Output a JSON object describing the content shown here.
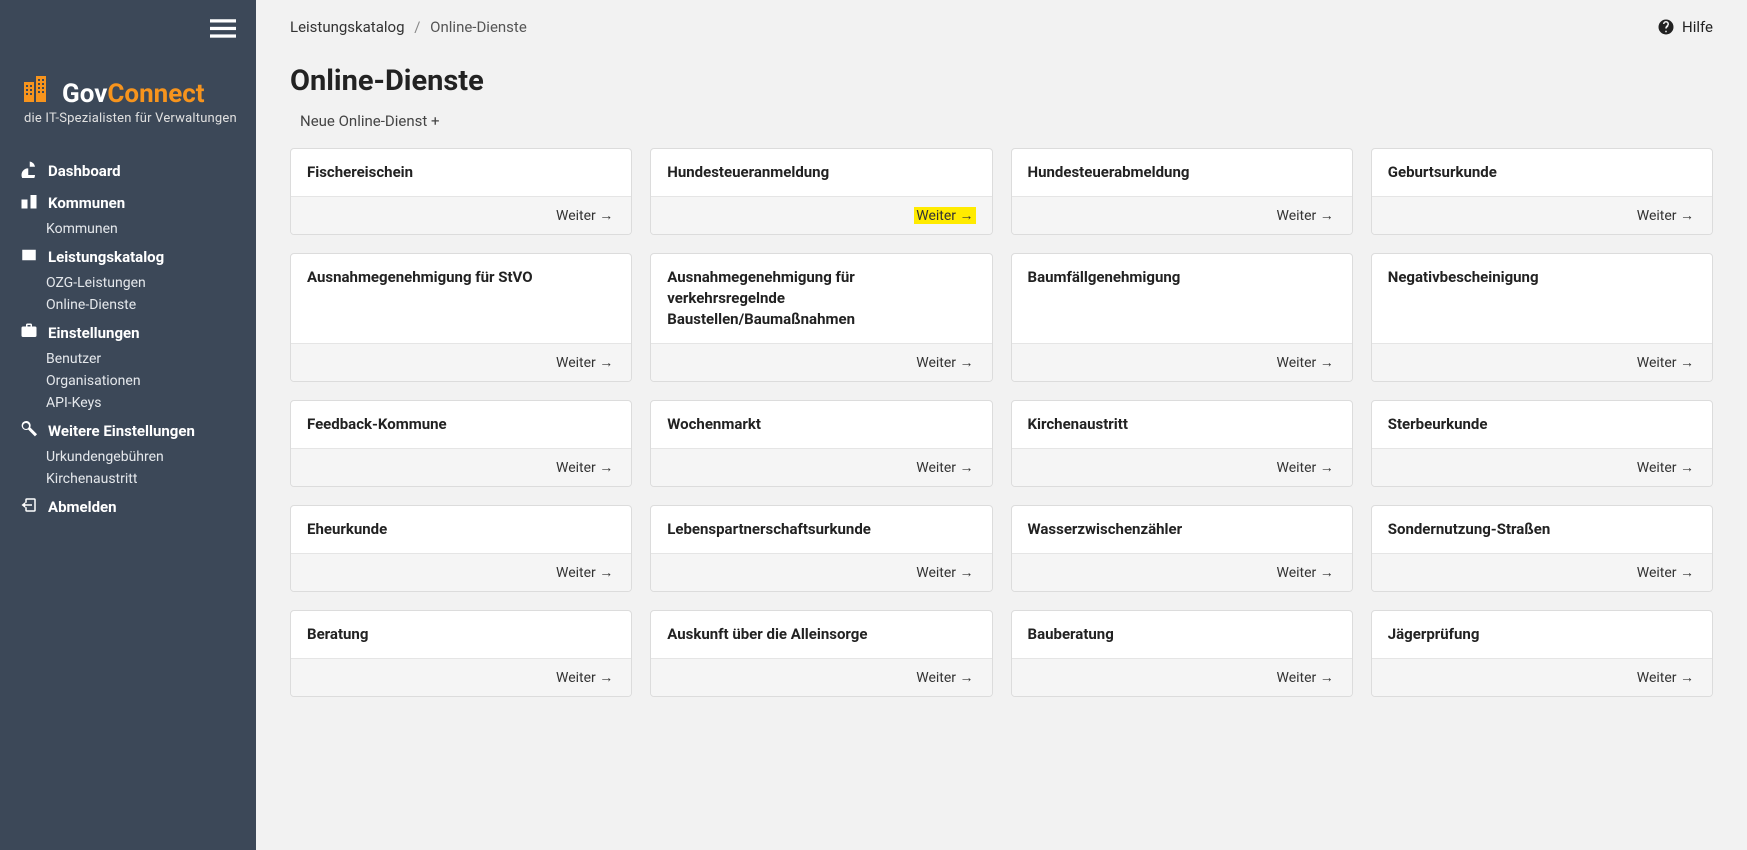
{
  "logo": {
    "gov": "Gov",
    "connect": "Connect",
    "subtitle": "die IT-Spezialisten für Verwaltungen"
  },
  "sidebar": {
    "groups": [
      {
        "label": "Dashboard",
        "sub": []
      },
      {
        "label": "Kommunen",
        "sub": [
          "Kommunen"
        ]
      },
      {
        "label": "Leistungskatalog",
        "sub": [
          "OZG-Leistungen",
          "Online-Dienste"
        ]
      },
      {
        "label": "Einstellungen",
        "sub": [
          "Benutzer",
          "Organisationen",
          "API-Keys"
        ]
      },
      {
        "label": "Weitere Einstellungen",
        "sub": [
          "Urkundengebühren",
          "Kirchenaustritt"
        ]
      },
      {
        "label": "Abmelden",
        "sub": []
      }
    ]
  },
  "breadcrumb": {
    "parent": "Leistungskatalog",
    "sep": "/",
    "current": "Online-Dienste"
  },
  "help": {
    "label": "Hilfe"
  },
  "page_title": "Online-Dienste",
  "add_link": "Neue Online-Dienst +",
  "weiter_label": "Weiter →",
  "cards": [
    {
      "title": "Fischereischein",
      "highlighted": false
    },
    {
      "title": "Hundesteueranmeldung",
      "highlighted": true
    },
    {
      "title": "Hundesteuerabmeldung",
      "highlighted": false
    },
    {
      "title": "Geburtsurkunde",
      "highlighted": false
    },
    {
      "title": "Ausnahmegenehmigung für StVO",
      "highlighted": false
    },
    {
      "title": "Ausnahmegenehmigung für verkehrsregelnde Baustellen/Baumaßnahmen",
      "highlighted": false
    },
    {
      "title": "Baumfällgenehmigung",
      "highlighted": false
    },
    {
      "title": "Negativbescheinigung",
      "highlighted": false
    },
    {
      "title": "Feedback-Kommune",
      "highlighted": false
    },
    {
      "title": "Wochenmarkt",
      "highlighted": false
    },
    {
      "title": "Kirchenaustritt",
      "highlighted": false
    },
    {
      "title": "Sterbeurkunde",
      "highlighted": false
    },
    {
      "title": "Eheurkunde",
      "highlighted": false
    },
    {
      "title": "Lebenspartnerschaftsurkunde",
      "highlighted": false
    },
    {
      "title": "Wasserzwischenzähler",
      "highlighted": false
    },
    {
      "title": "Sondernutzung-Straßen",
      "highlighted": false
    },
    {
      "title": "Beratung",
      "highlighted": false
    },
    {
      "title": "Auskunft über die Alleinsorge",
      "highlighted": false
    },
    {
      "title": "Bauberatung",
      "highlighted": false
    },
    {
      "title": "Jägerprüfung",
      "highlighted": false
    }
  ]
}
